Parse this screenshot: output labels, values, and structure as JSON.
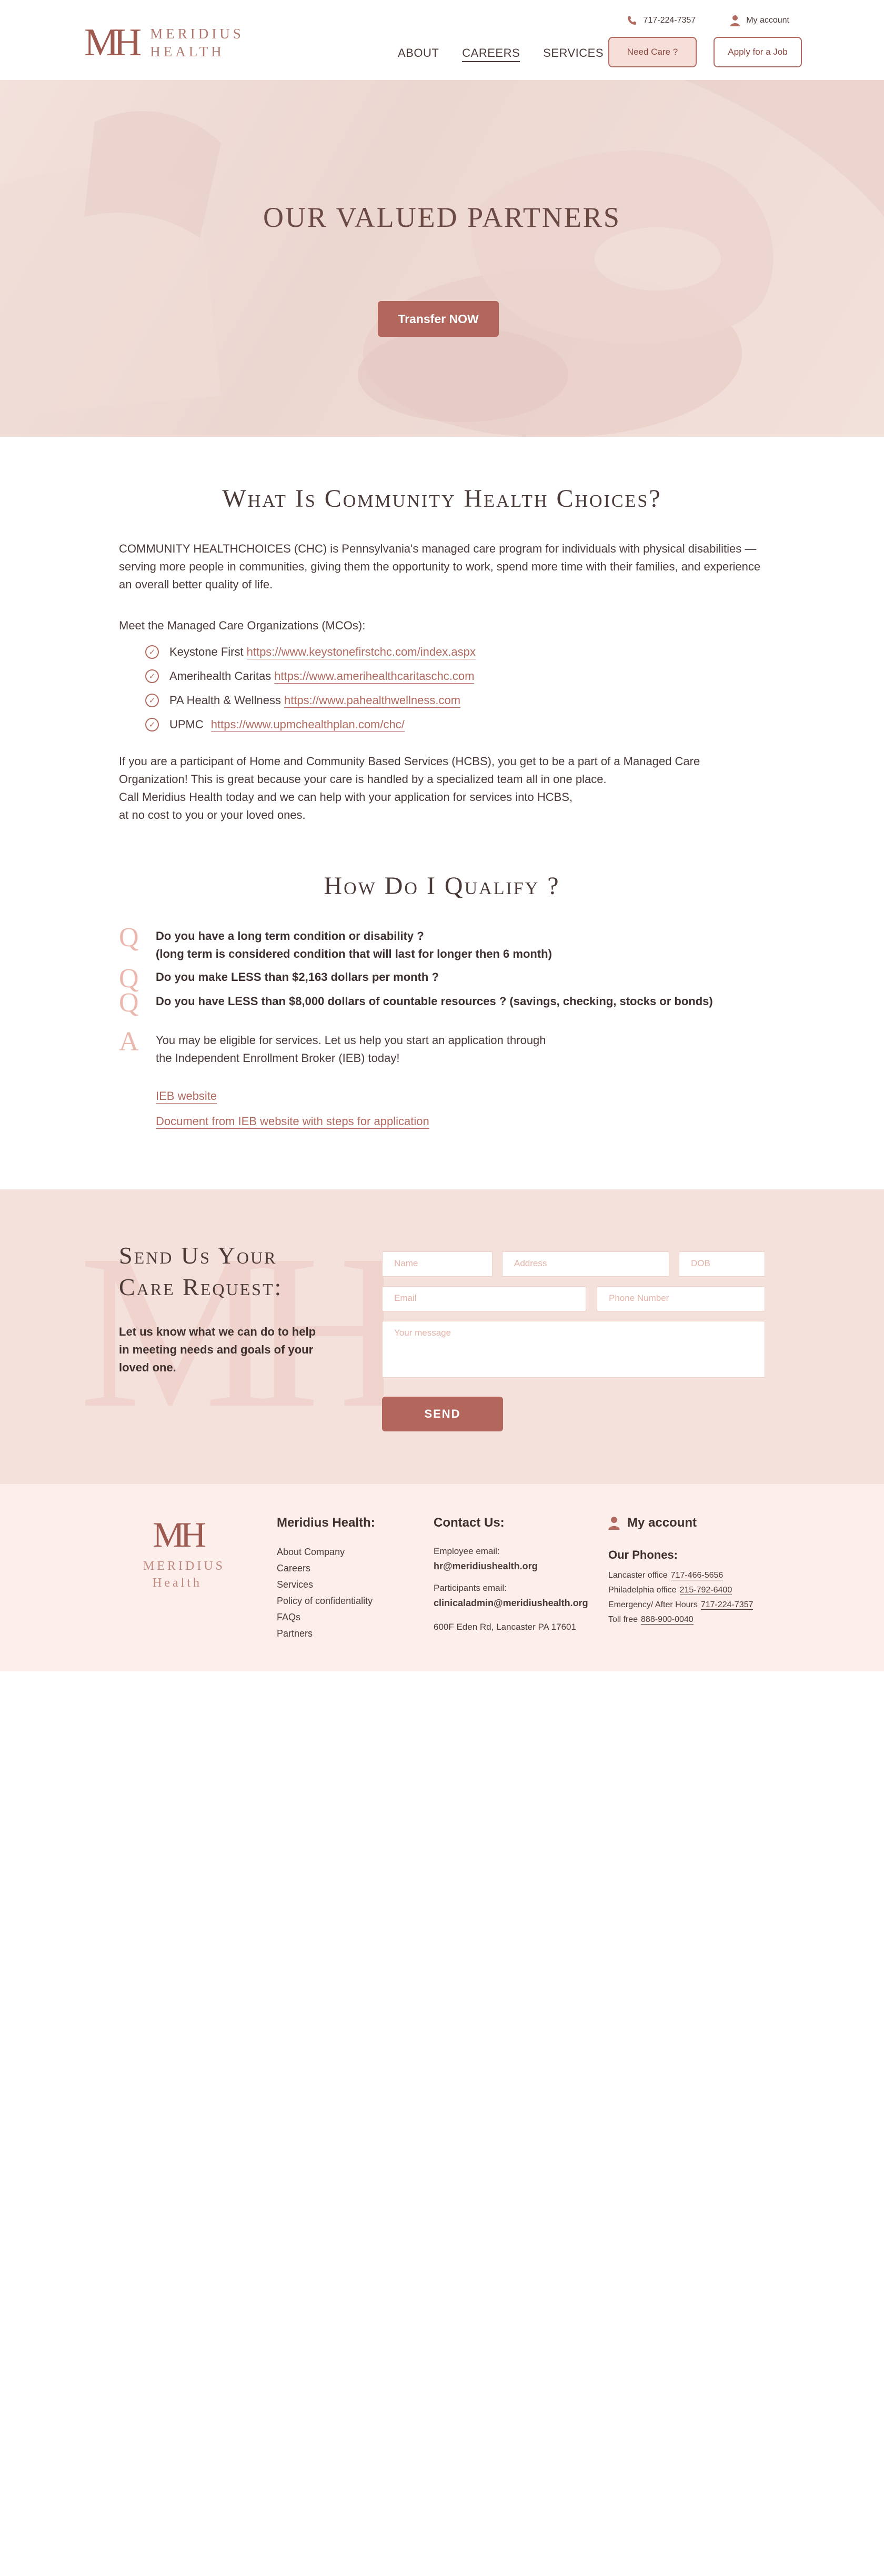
{
  "header": {
    "logo": {
      "mark": "MH",
      "line1": "MERIDIUS",
      "line2": "HEALTH"
    },
    "phone": "717-224-7357",
    "account": "My account",
    "nav": [
      "ABOUT",
      "CAREERS",
      "SERVICES"
    ],
    "need_care": "Need Care ?",
    "apply_job": "Apply for a Job"
  },
  "hero": {
    "title": "OUR VALUED PARTNERS",
    "button": "Transfer NOW"
  },
  "chc": {
    "title": "What Is Community Health Choices?",
    "intro": "COMMUNITY HEALTHCHOICES (CHC) is Pennsylvania's managed care program for individuals with physical disabilities — serving more people in communities, giving them the opportunity to work, spend more time with their families, and experience an overall better quality of life.",
    "mco_lead": "Meet the Managed Care Organizations (MCOs):",
    "mcos": [
      {
        "name": "Keystone First",
        "url": "https://www.keystonefirstchc.com/index.aspx"
      },
      {
        "name": "Amerihealth Caritas",
        "url": "https://www.amerihealthcaritaschc.com"
      },
      {
        "name": "PA Health & Wellness",
        "url": "https://www.pahealthwellness.com"
      },
      {
        "name": "UPMC",
        "url": "https://www.upmchealthplan.com/chc/"
      }
    ],
    "outro_1": "If you are a participant of Home and Community Based Services (HCBS), you get to be a part of a Managed Care Organization! This is great because your care is handled by a specialized team all in one place.",
    "outro_2": "Call Meridius Health today and we can help with your application for services into HCBS,",
    "outro_3": "at no cost to you or your loved ones."
  },
  "qualify": {
    "title": "How Do I Qualify ?",
    "q_letter": "Q",
    "a_letter": "A",
    "questions": [
      {
        "line1": "Do you have a long term condition or disability ?",
        "line2": "(long term is considered condition that will last for longer then 6 month)"
      },
      {
        "line1": "Do you make LESS than $2,163 dollars per month ?"
      },
      {
        "line1": "Do you have LESS than $8,000 dollars of countable resources ? (savings, checking, stocks or bonds)"
      }
    ],
    "answer_1": "You may be eligible for services. Let us help you start an application through",
    "answer_2": "the Independent Enrollment Broker (IEB) today!",
    "link_1": "IEB website",
    "link_2": "Document from IEB website with steps for application"
  },
  "request": {
    "title_1": "Send Us Your",
    "title_2": "Care Request:",
    "subtitle": "Let us know what we can do to help in meeting needs and goals of your loved one.",
    "placeholders": {
      "name": "Name",
      "address": "Address",
      "dob": "DOB",
      "email": "Email",
      "phone": "Phone Number",
      "message": "Your message"
    },
    "send": "SEND"
  },
  "footer": {
    "logo": {
      "mark": "MH",
      "line1": "MERIDIUS",
      "line2": "Health"
    },
    "col1_title": "Meridius Health:",
    "col1_links": [
      "About Company",
      "Careers",
      "Services",
      "Policy of confidentiality",
      "FAQs",
      "Partners"
    ],
    "col2_title": "Contact Us:",
    "employee_label": "Employee email:",
    "employee_email": "hr@meridiushealth.org",
    "participant_label": "Participants email:",
    "participant_email": "clinicaladmin@meridiushealth.org",
    "address": "600F Eden Rd, Lancaster PA 17601",
    "account": "My account",
    "phones_title": "Our Phones:",
    "phones": [
      {
        "label": "Lancaster office",
        "number": "717-466-5656"
      },
      {
        "label": "Philadelphia office",
        "number": "215-792-6400"
      },
      {
        "label": "Emergency/ After Hours",
        "number": "717-224-7357"
      },
      {
        "label": "Toll free",
        "number": "888-900-0040"
      }
    ]
  },
  "colors": {
    "accent": "#b2665c",
    "accent_light": "#f5e1dc",
    "text": "#4a3a38"
  }
}
